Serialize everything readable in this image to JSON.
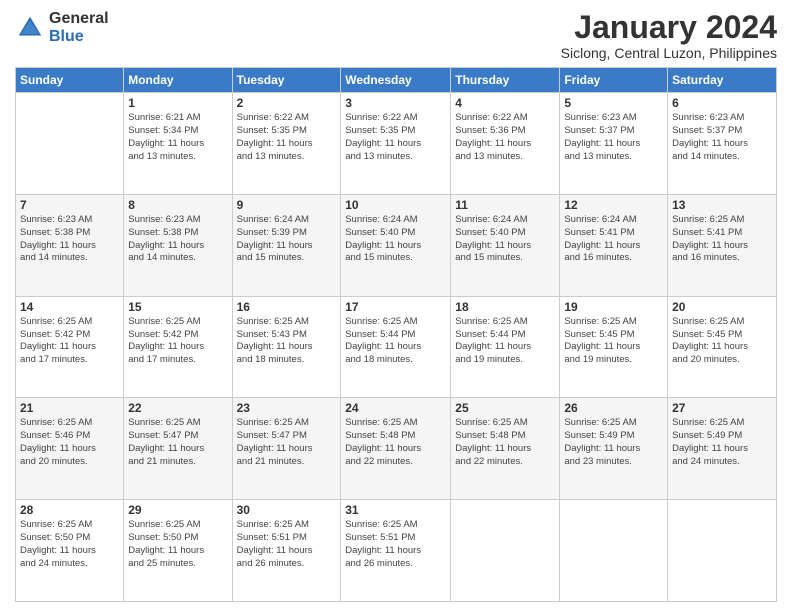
{
  "logo": {
    "general": "General",
    "blue": "Blue"
  },
  "title": "January 2024",
  "subtitle": "Siclong, Central Luzon, Philippines",
  "days_of_week": [
    "Sunday",
    "Monday",
    "Tuesday",
    "Wednesday",
    "Thursday",
    "Friday",
    "Saturday"
  ],
  "weeks": [
    [
      {
        "day": "",
        "info": ""
      },
      {
        "day": "1",
        "info": "Sunrise: 6:21 AM\nSunset: 5:34 PM\nDaylight: 11 hours\nand 13 minutes."
      },
      {
        "day": "2",
        "info": "Sunrise: 6:22 AM\nSunset: 5:35 PM\nDaylight: 11 hours\nand 13 minutes."
      },
      {
        "day": "3",
        "info": "Sunrise: 6:22 AM\nSunset: 5:35 PM\nDaylight: 11 hours\nand 13 minutes."
      },
      {
        "day": "4",
        "info": "Sunrise: 6:22 AM\nSunset: 5:36 PM\nDaylight: 11 hours\nand 13 minutes."
      },
      {
        "day": "5",
        "info": "Sunrise: 6:23 AM\nSunset: 5:37 PM\nDaylight: 11 hours\nand 13 minutes."
      },
      {
        "day": "6",
        "info": "Sunrise: 6:23 AM\nSunset: 5:37 PM\nDaylight: 11 hours\nand 14 minutes."
      }
    ],
    [
      {
        "day": "7",
        "info": "Sunrise: 6:23 AM\nSunset: 5:38 PM\nDaylight: 11 hours\nand 14 minutes."
      },
      {
        "day": "8",
        "info": "Sunrise: 6:23 AM\nSunset: 5:38 PM\nDaylight: 11 hours\nand 14 minutes."
      },
      {
        "day": "9",
        "info": "Sunrise: 6:24 AM\nSunset: 5:39 PM\nDaylight: 11 hours\nand 15 minutes."
      },
      {
        "day": "10",
        "info": "Sunrise: 6:24 AM\nSunset: 5:40 PM\nDaylight: 11 hours\nand 15 minutes."
      },
      {
        "day": "11",
        "info": "Sunrise: 6:24 AM\nSunset: 5:40 PM\nDaylight: 11 hours\nand 15 minutes."
      },
      {
        "day": "12",
        "info": "Sunrise: 6:24 AM\nSunset: 5:41 PM\nDaylight: 11 hours\nand 16 minutes."
      },
      {
        "day": "13",
        "info": "Sunrise: 6:25 AM\nSunset: 5:41 PM\nDaylight: 11 hours\nand 16 minutes."
      }
    ],
    [
      {
        "day": "14",
        "info": "Sunrise: 6:25 AM\nSunset: 5:42 PM\nDaylight: 11 hours\nand 17 minutes."
      },
      {
        "day": "15",
        "info": "Sunrise: 6:25 AM\nSunset: 5:42 PM\nDaylight: 11 hours\nand 17 minutes."
      },
      {
        "day": "16",
        "info": "Sunrise: 6:25 AM\nSunset: 5:43 PM\nDaylight: 11 hours\nand 18 minutes."
      },
      {
        "day": "17",
        "info": "Sunrise: 6:25 AM\nSunset: 5:44 PM\nDaylight: 11 hours\nand 18 minutes."
      },
      {
        "day": "18",
        "info": "Sunrise: 6:25 AM\nSunset: 5:44 PM\nDaylight: 11 hours\nand 19 minutes."
      },
      {
        "day": "19",
        "info": "Sunrise: 6:25 AM\nSunset: 5:45 PM\nDaylight: 11 hours\nand 19 minutes."
      },
      {
        "day": "20",
        "info": "Sunrise: 6:25 AM\nSunset: 5:45 PM\nDaylight: 11 hours\nand 20 minutes."
      }
    ],
    [
      {
        "day": "21",
        "info": "Sunrise: 6:25 AM\nSunset: 5:46 PM\nDaylight: 11 hours\nand 20 minutes."
      },
      {
        "day": "22",
        "info": "Sunrise: 6:25 AM\nSunset: 5:47 PM\nDaylight: 11 hours\nand 21 minutes."
      },
      {
        "day": "23",
        "info": "Sunrise: 6:25 AM\nSunset: 5:47 PM\nDaylight: 11 hours\nand 21 minutes."
      },
      {
        "day": "24",
        "info": "Sunrise: 6:25 AM\nSunset: 5:48 PM\nDaylight: 11 hours\nand 22 minutes."
      },
      {
        "day": "25",
        "info": "Sunrise: 6:25 AM\nSunset: 5:48 PM\nDaylight: 11 hours\nand 22 minutes."
      },
      {
        "day": "26",
        "info": "Sunrise: 6:25 AM\nSunset: 5:49 PM\nDaylight: 11 hours\nand 23 minutes."
      },
      {
        "day": "27",
        "info": "Sunrise: 6:25 AM\nSunset: 5:49 PM\nDaylight: 11 hours\nand 24 minutes."
      }
    ],
    [
      {
        "day": "28",
        "info": "Sunrise: 6:25 AM\nSunset: 5:50 PM\nDaylight: 11 hours\nand 24 minutes."
      },
      {
        "day": "29",
        "info": "Sunrise: 6:25 AM\nSunset: 5:50 PM\nDaylight: 11 hours\nand 25 minutes."
      },
      {
        "day": "30",
        "info": "Sunrise: 6:25 AM\nSunset: 5:51 PM\nDaylight: 11 hours\nand 26 minutes."
      },
      {
        "day": "31",
        "info": "Sunrise: 6:25 AM\nSunset: 5:51 PM\nDaylight: 11 hours\nand 26 minutes."
      },
      {
        "day": "",
        "info": ""
      },
      {
        "day": "",
        "info": ""
      },
      {
        "day": "",
        "info": ""
      }
    ]
  ]
}
